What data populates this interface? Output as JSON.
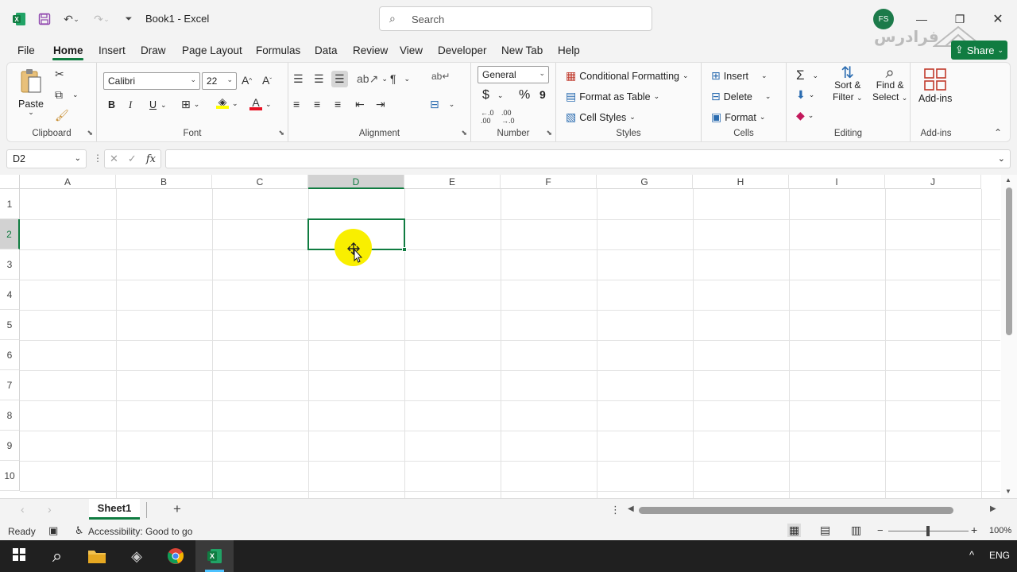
{
  "title_bar": {
    "doc_title": "Book1  -  Excel",
    "search_placeholder": "Search",
    "avatar_initials": "FS",
    "watermark_text": "فرادرس"
  },
  "tabs": [
    "File",
    "Home",
    "Insert",
    "Draw",
    "Page Layout",
    "Formulas",
    "Data",
    "Review",
    "View",
    "Developer",
    "New Tab",
    "Help"
  ],
  "share_label": "Share",
  "ribbon": {
    "clipboard": {
      "paste": "Paste",
      "group": "Clipboard"
    },
    "font": {
      "name": "Calibri",
      "size": "22",
      "group": "Font",
      "bold": "B",
      "italic": "I",
      "underline": "U"
    },
    "alignment": {
      "group": "Alignment"
    },
    "number": {
      "format": "General",
      "group": "Number",
      "currency": "$",
      "percent": "%",
      "comma": "9"
    },
    "styles": {
      "conditional": "Conditional Formatting",
      "format_table": "Format as Table",
      "cell_styles": "Cell Styles",
      "group": "Styles"
    },
    "cells": {
      "insert": "Insert",
      "delete": "Delete",
      "format": "Format",
      "group": "Cells"
    },
    "editing": {
      "sort_filter": "Sort &",
      "sort_filter2": "Filter",
      "find_select": "Find &",
      "find_select2": "Select",
      "group": "Editing"
    },
    "addins": {
      "label": "Add-ins",
      "group": "Add-ins"
    }
  },
  "formula_bar": {
    "name_box": "D2",
    "formula": "",
    "fx": "fx"
  },
  "grid": {
    "columns": [
      "A",
      "B",
      "C",
      "D",
      "E",
      "F",
      "G",
      "H",
      "I",
      "J"
    ],
    "rows": [
      "1",
      "2",
      "3",
      "4",
      "5",
      "6",
      "7",
      "8",
      "9",
      "10"
    ],
    "selected_cell": "D2"
  },
  "sheet_tabs": {
    "active": "Sheet1",
    "add": "+"
  },
  "status_bar": {
    "ready": "Ready",
    "accessibility": "Accessibility: Good to go",
    "zoom": "100%"
  },
  "taskbar": {
    "lang": "ENG"
  },
  "colors": {
    "accent": "#107c41",
    "highlight": "#f9ef00"
  }
}
